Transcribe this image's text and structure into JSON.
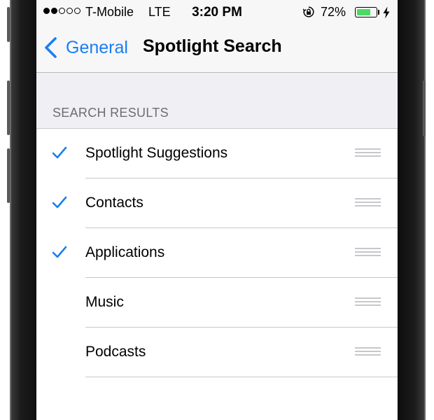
{
  "status_bar": {
    "signal_filled": 2,
    "signal_total": 5,
    "carrier": "T-Mobile",
    "network": "LTE",
    "time": "3:20 PM",
    "orientation_lock_icon": "orientation-lock-icon",
    "battery_percent": "72%",
    "battery_level": 0.72,
    "charging_icon": "lightning-bolt-icon"
  },
  "nav": {
    "back_label": "General",
    "back_icon": "chevron-left-icon",
    "title": "Spotlight Search"
  },
  "section": {
    "header": "SEARCH RESULTS"
  },
  "items": [
    {
      "label": "Spotlight Suggestions",
      "checked": true
    },
    {
      "label": "Contacts",
      "checked": true
    },
    {
      "label": "Applications",
      "checked": true
    },
    {
      "label": "Music",
      "checked": false
    },
    {
      "label": "Podcasts",
      "checked": false
    }
  ],
  "colors": {
    "accent": "#1a7ef5",
    "battery": "#4cd964",
    "group_background": "#efeff4",
    "section_header_text": "#6d6d72",
    "separator": "#c8c7cc",
    "reorder_handle": "#c7c7cc"
  }
}
